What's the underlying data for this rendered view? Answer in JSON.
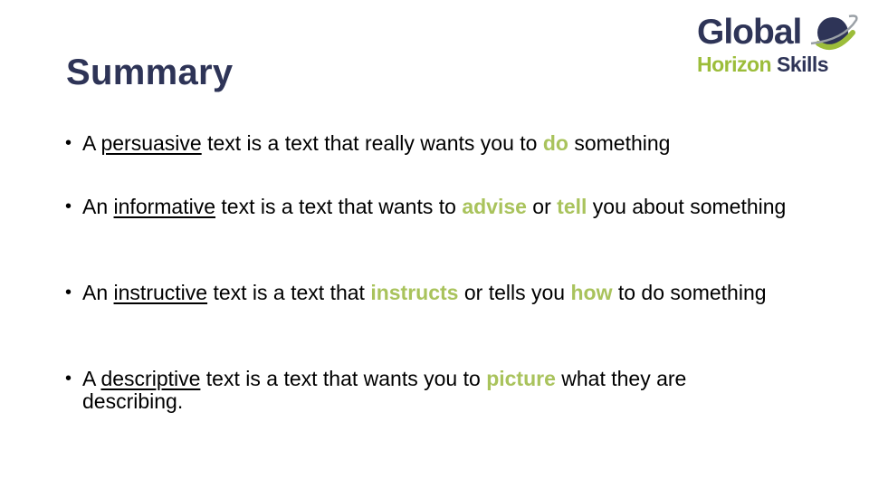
{
  "slide": {
    "title": "Summary",
    "colors": {
      "title": "#2e3457",
      "highlight": "#a9c35c",
      "logo_navy": "#2e3457",
      "logo_green": "#9cbd3a"
    }
  },
  "logo": {
    "line1": "Global",
    "line2_a": "Horizon",
    "line2_b": "Skills",
    "icon": "planet-ring-icon"
  },
  "bullets": [
    {
      "pre": "A ",
      "term": "persuasive",
      "mid1": " text is a text that really wants you to ",
      "hl1": "do",
      "mid2": " something",
      "hl2": "",
      "post": ""
    },
    {
      "pre": "An ",
      "term": "informative",
      "mid1": " text is a text that wants to ",
      "hl1": "advise",
      "mid2": " or ",
      "hl2": "tell",
      "post": " you about something"
    },
    {
      "pre": "An ",
      "term": "instructive",
      "mid1": " text is a text that ",
      "hl1": "instructs",
      "mid2": " or tells you ",
      "hl2": "how",
      "post": " to do something"
    },
    {
      "pre": "A ",
      "term": "descriptive",
      "mid1": " text is a text that wants you to ",
      "hl1": "picture",
      "mid2": " what they are describing.",
      "hl2": "",
      "post": ""
    }
  ],
  "bullet_char": "•"
}
